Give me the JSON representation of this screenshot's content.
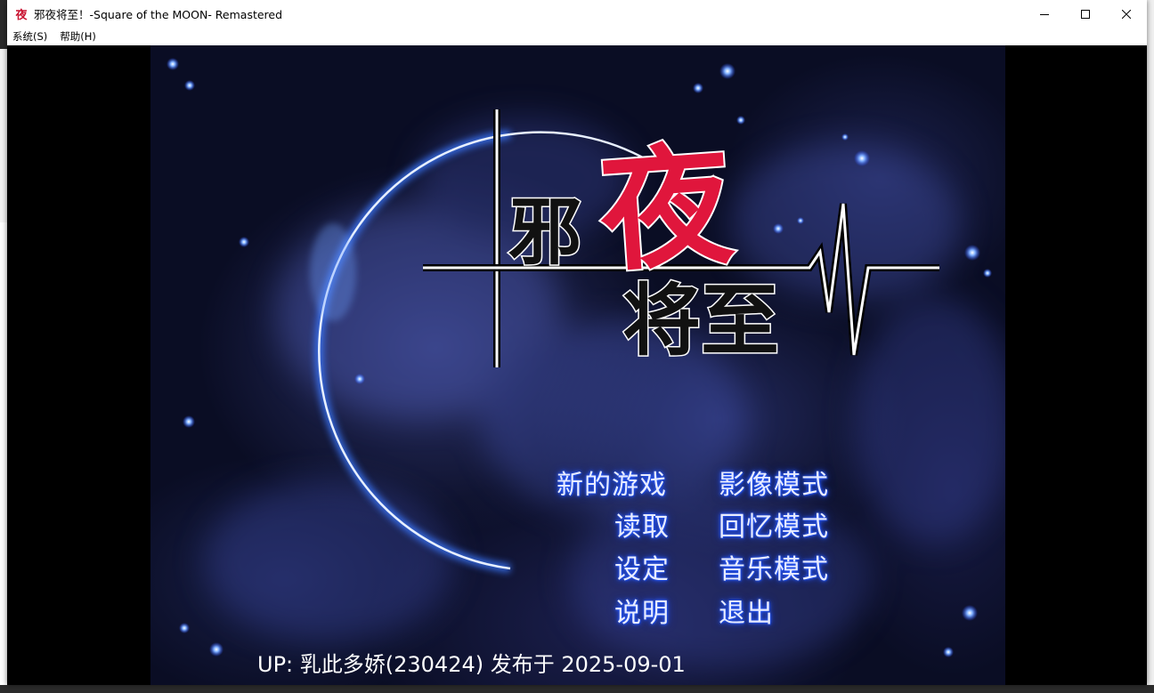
{
  "window": {
    "icon_char": "夜",
    "title": "邪夜将至！-Square of the MOON- Remastered"
  },
  "menubar": {
    "items": [
      "系统(S)",
      "帮助(H)"
    ]
  },
  "logo": {
    "char_1": "邪",
    "char_2": "夜",
    "line_2": "将至"
  },
  "main_menu": {
    "left": [
      "新的游戏",
      "读取",
      "设定",
      "说明"
    ],
    "right": [
      "影像模式",
      "回忆模式",
      "音乐模式",
      "退出"
    ]
  },
  "footer": {
    "text": "UP: 乳此多娇(230424) 发布于 2025-09-01"
  },
  "colors": {
    "logo_accent": "#e0163c",
    "menu_glow": "#2a5cff",
    "background": "#0a0d24"
  }
}
